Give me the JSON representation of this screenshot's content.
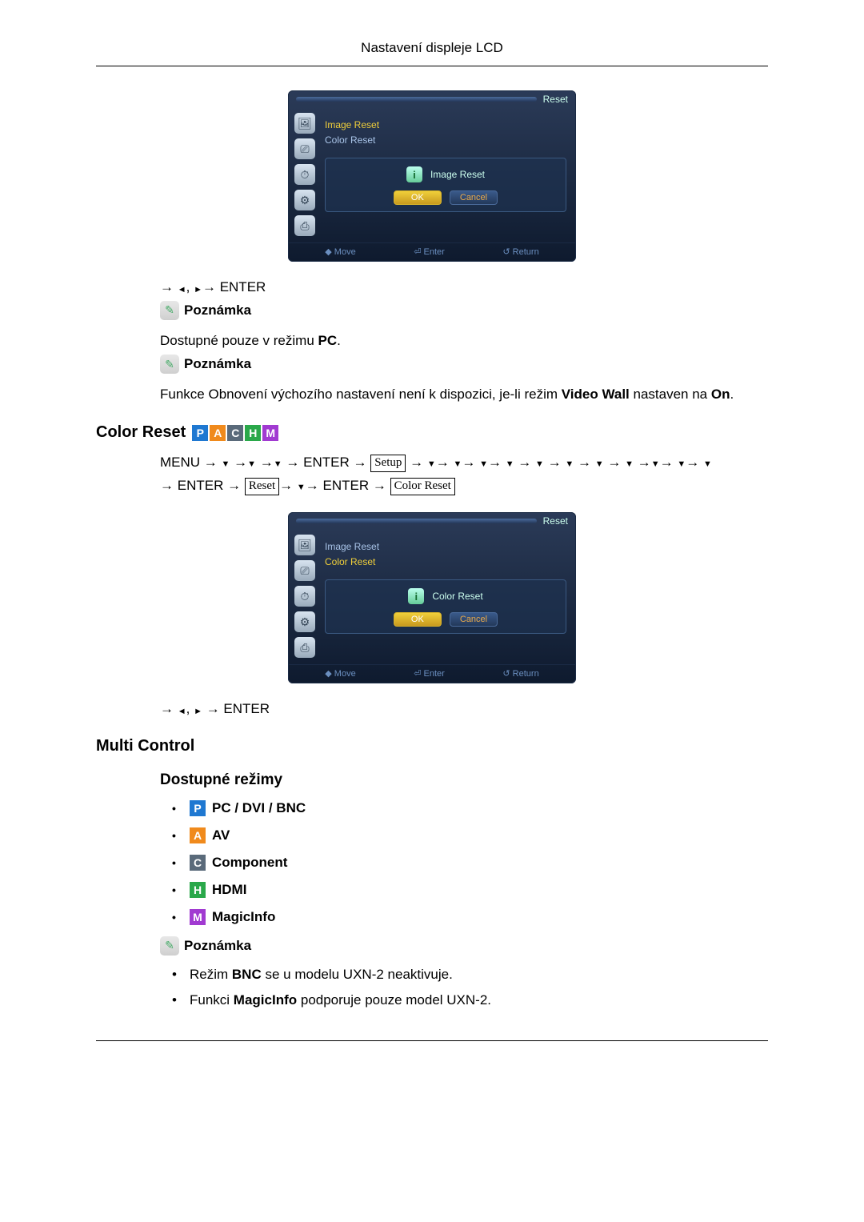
{
  "header": {
    "title": "Nastavení displeje LCD"
  },
  "osd1": {
    "title": "Reset",
    "items": [
      "Image Reset",
      "Color Reset"
    ],
    "selected_index": 0,
    "dialog_label": "Image Reset",
    "ok": "OK",
    "cancel": "Cancel",
    "footer": {
      "move": "◆ Move",
      "enter": "⏎ Enter",
      "return": "↺ Return"
    }
  },
  "nav1": {
    "prefix": "→ ",
    "sep": ", ",
    "suffix": "→ ENTER"
  },
  "notes": {
    "label": "Poznámka"
  },
  "note1_text_a": "Dostupné pouze v režimu ",
  "note1_text_b": "PC",
  "note1_text_c": ".",
  "note2_text_a": "Funkce Obnovení výchozího nastavení není k dispozici, je-li režim ",
  "note2_text_b": "Video Wall",
  "note2_text_c": " nastaven na ",
  "note2_text_d": "On",
  "note2_text_e": ".",
  "color_reset": {
    "heading": "Color Reset",
    "badges": [
      "P",
      "A",
      "C",
      "H",
      "M"
    ],
    "path": {
      "menu": "MENU",
      "enter": "ENTER",
      "box_setup": "Setup",
      "box_reset": "Reset",
      "box_color_reset": "Color Reset"
    }
  },
  "osd2": {
    "title": "Reset",
    "items": [
      "Image Reset",
      "Color Reset"
    ],
    "selected_index": 1,
    "dialog_label": "Color Reset",
    "ok": "OK",
    "cancel": "Cancel",
    "footer": {
      "move": "◆ Move",
      "enter": "⏎ Enter",
      "return": "↺ Return"
    }
  },
  "nav2": {
    "prefix": "→ ",
    "sep": ", ",
    "suffix": " → ENTER"
  },
  "multi_control": {
    "heading": "Multi Control"
  },
  "modes": {
    "heading": "Dostupné režimy",
    "items": [
      {
        "badge": "P",
        "label": "PC / DVI / BNC"
      },
      {
        "badge": "A",
        "label": "AV"
      },
      {
        "badge": "C",
        "label": "Component"
      },
      {
        "badge": "H",
        "label": "HDMI"
      },
      {
        "badge": "M",
        "label": "MagicInfo"
      }
    ]
  },
  "mode_notes": {
    "li1_a": "Režim ",
    "li1_b": "BNC",
    "li1_c": " se u modelu UXN-2 neaktivuje.",
    "li2_a": "Funkci ",
    "li2_b": "MagicInfo",
    "li2_c": " podporuje pouze model UXN-2."
  }
}
